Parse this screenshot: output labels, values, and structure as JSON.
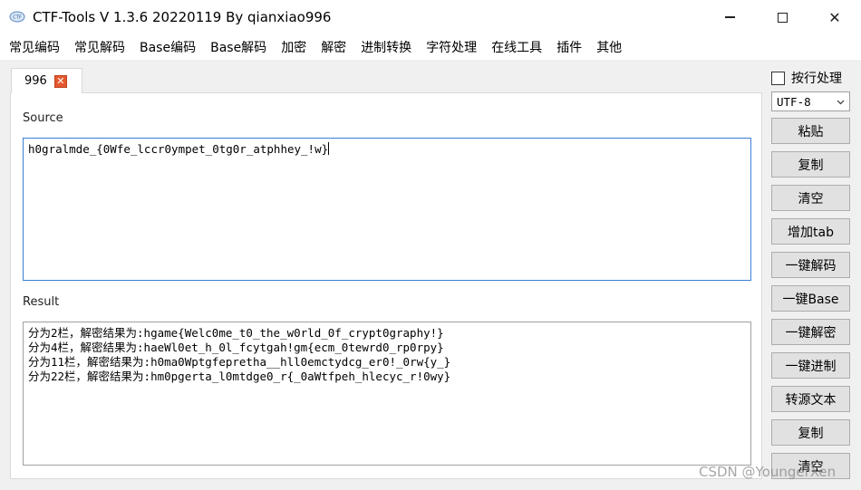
{
  "window": {
    "title": "CTF-Tools V 1.3.6 20220119 By qianxiao996",
    "close_glyph": "✕"
  },
  "menu": [
    "常见编码",
    "常见解码",
    "Base编码",
    "Base解码",
    "加密",
    "解密",
    "进制转换",
    "字符处理",
    "在线工具",
    "插件",
    "其他"
  ],
  "tab": {
    "label": "996",
    "close_glyph": "✕"
  },
  "source": {
    "label": "Source",
    "value": "h0gralmde_{0Wfe_lccr0ympet_0tg0r_atphhey_!w}"
  },
  "result": {
    "label": "Result",
    "lines": [
      "分为2栏，解密结果为:hgame{Welc0me_t0_the_w0rld_0f_crypt0graphy!}",
      "分为4栏，解密结果为:haeWl0et_h_0l_fcytgah!gm{ecm_0tewrd0_rp0rpy}",
      "分为11栏，解密结果为:h0ma0Wptgfepretha__hll0emctydcg_er0!_0rw{y_}",
      "分为22栏，解密结果为:hm0pgerta_l0mtdge0_r{_0aWtfpeh_hlecyc_r!0wy}"
    ]
  },
  "sidebar": {
    "checkbox_label": "按行处理",
    "encoding": "UTF-8",
    "buttons": [
      "粘贴",
      "复制",
      "清空",
      "增加tab",
      "一键解码",
      "一键Base",
      "一键解密",
      "一键进制",
      "转源文本",
      "复制",
      "清空"
    ]
  },
  "watermark": "CSDN @YoungerXen",
  "colors": {
    "tab_close": "#e5592f",
    "focus_border": "#3c7fd4"
  }
}
